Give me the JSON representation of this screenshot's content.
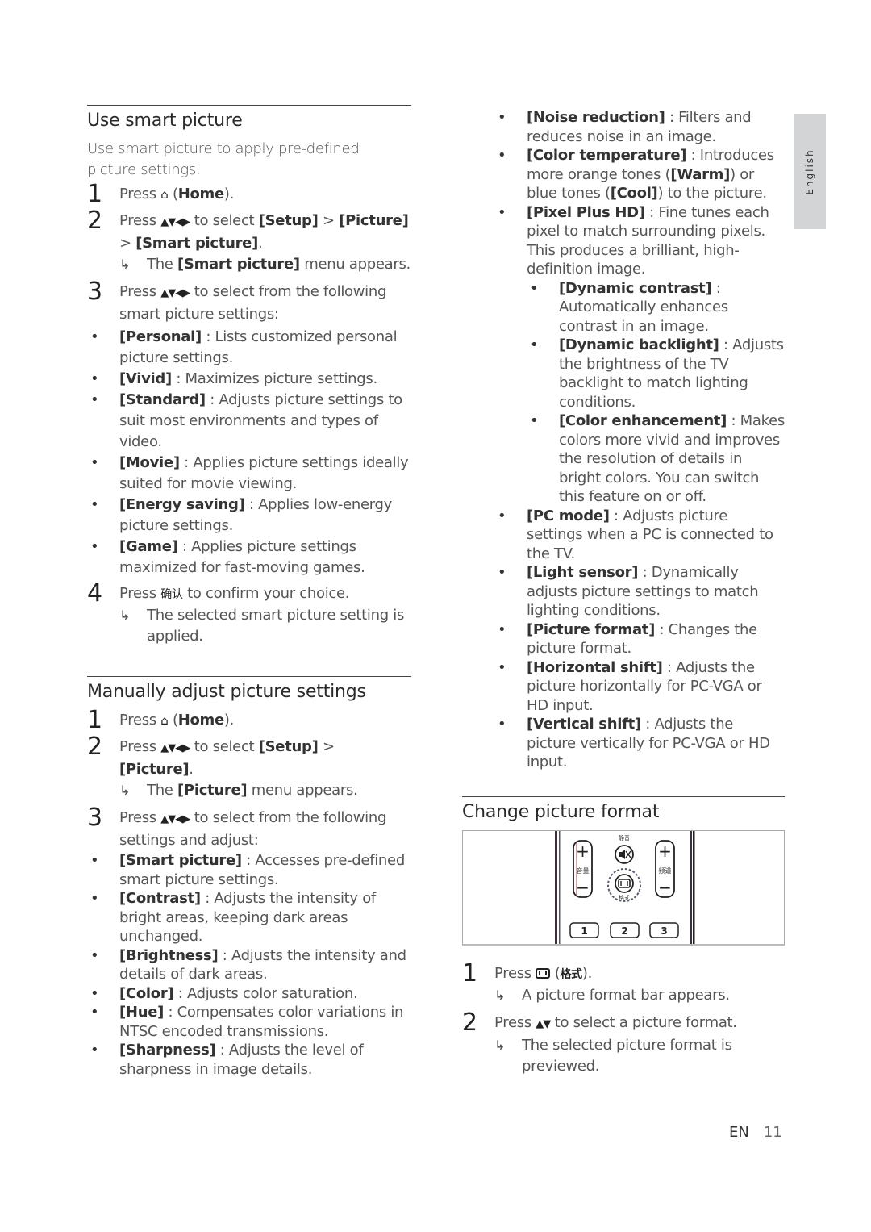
{
  "language_tab": "English",
  "footer": {
    "lang": "EN",
    "page": "11"
  },
  "smart": {
    "title": "Use smart picture",
    "intro": "Use smart picture to apply pre-defined picture settings.",
    "step1": {
      "num": "1",
      "pre": "Press ",
      "icon": "⌂",
      "mid": " (",
      "b": "Home",
      "post": ")."
    },
    "step2": {
      "num": "2",
      "pre": "Press ",
      "arrows": "▲▼◀▶",
      "mid": " to select ",
      "b1": "[Setup]",
      "gt1": " > ",
      "b2": "[Picture]",
      "gt2": " > ",
      "b3": "[Smart picture]",
      "post": ".",
      "result_arrow": "↳",
      "result_pre": "The ",
      "result_b": "[Smart picture]",
      "result_post": " menu appears."
    },
    "step3": {
      "num": "3",
      "pre": "Press ",
      "arrows": "▲▼◀▶",
      "post": " to select from the following smart picture settings:"
    },
    "items": [
      {
        "b": "[Personal]",
        "t": " : Lists customized personal picture settings."
      },
      {
        "b": "[Vivid]",
        "t": " : Maximizes picture settings."
      },
      {
        "b": "[Standard]",
        "t": " : Adjusts picture settings to suit most environments and types of video."
      },
      {
        "b": "[Movie]",
        "t": " : Applies picture settings ideally suited for movie viewing."
      },
      {
        "b": "[Energy saving]",
        "t": " : Applies low-energy picture settings."
      },
      {
        "b": "[Game]",
        "t": " : Applies picture settings maximized for fast-moving games."
      }
    ],
    "step4": {
      "num": "4",
      "pre": "Press ",
      "cjk": "确认",
      "post": " to confirm your choice.",
      "result_arrow": "↳",
      "result": "The selected smart picture setting is applied."
    }
  },
  "manual": {
    "title": "Manually adjust picture settings",
    "step1": {
      "num": "1",
      "pre": "Press ",
      "icon": "⌂",
      "mid": " (",
      "b": "Home",
      "post": ")."
    },
    "step2": {
      "num": "2",
      "pre": "Press ",
      "arrows": "▲▼◀▶",
      "mid": " to select ",
      "b1": "[Setup]",
      "gt1": " > ",
      "b2": "[Picture]",
      "post": ".",
      "result_arrow": "↳",
      "result_pre": "The ",
      "result_b": "[Picture]",
      "result_post": " menu appears."
    },
    "step3": {
      "num": "3",
      "pre": "Press ",
      "arrows": "▲▼◀▶",
      "post": " to select from the following settings and adjust:"
    },
    "items": [
      {
        "b": "[Smart picture]",
        "t": " : Accesses pre-defined smart picture settings."
      },
      {
        "b": "[Contrast]",
        "t": " : Adjusts the intensity of bright areas, keeping dark areas unchanged."
      },
      {
        "b": "[Brightness]",
        "t": " : Adjusts the intensity and details of dark areas."
      },
      {
        "b": "[Color]",
        "t": " : Adjusts color saturation."
      },
      {
        "b": "[Hue]",
        "t": " : Compensates color variations in NTSC encoded transmissions."
      },
      {
        "b": "[Sharpness]",
        "t": " : Adjusts the level of sharpness in image details."
      }
    ],
    "items_cont": [
      {
        "b": "[Noise reduction]",
        "t": " : Filters and reduces noise in an image."
      },
      {
        "b": "[Color temperature]",
        "t1": " : Introduces more orange tones (",
        "b2": "[Warm]",
        "t2": ") or blue tones (",
        "b3": "[Cool]",
        "t3": ") to the picture."
      },
      {
        "b": "[Pixel Plus HD]",
        "t": " : Fine tunes each pixel to match surrounding pixels. This produces a brilliant, high-definition image."
      }
    ],
    "sub_items": [
      {
        "b": "[Dynamic contrast]",
        "t": " : Automatically enhances contrast in an image."
      },
      {
        "b": "[Dynamic backlight]",
        "t": " : Adjusts the brightness of the TV backlight to match lighting conditions."
      },
      {
        "b": "[Color enhancement]",
        "t": " : Makes colors more vivid and improves the resolution of details in bright colors. You can switch this feature on or off."
      }
    ],
    "items_after": [
      {
        "b": "[PC mode]",
        "t": " : Adjusts picture settings when a PC is connected to the TV."
      },
      {
        "b": "[Light sensor]",
        "t": " : Dynamically adjusts picture settings to match lighting conditions."
      },
      {
        "b": "[Picture format]",
        "t": " : Changes the picture format."
      },
      {
        "b": "[Horizontal shift]",
        "t": " : Adjusts the picture horizontally for PC-VGA or HD input."
      },
      {
        "b": "[Vertical shift]",
        "t": " : Adjusts the picture vertically for PC-VGA or HD input."
      }
    ]
  },
  "format": {
    "title": "Change picture format",
    "remote": {
      "mute_label": "静音",
      "vol_label": "音量",
      "ch_label": "频道",
      "format_label": "格式",
      "plus": "+",
      "minus": "−",
      "keys": [
        "1",
        "2",
        "3"
      ]
    },
    "step1": {
      "num": "1",
      "pre": "Press ",
      "mid": " (",
      "cjk": "格式",
      "post": ").",
      "result_arrow": "↳",
      "result": "A picture format bar appears."
    },
    "step2": {
      "num": "2",
      "pre": "Press ",
      "arrows": "▲▼",
      "post": " to select a picture format.",
      "result_arrow": "↳",
      "result": "The selected picture format is previewed."
    }
  }
}
